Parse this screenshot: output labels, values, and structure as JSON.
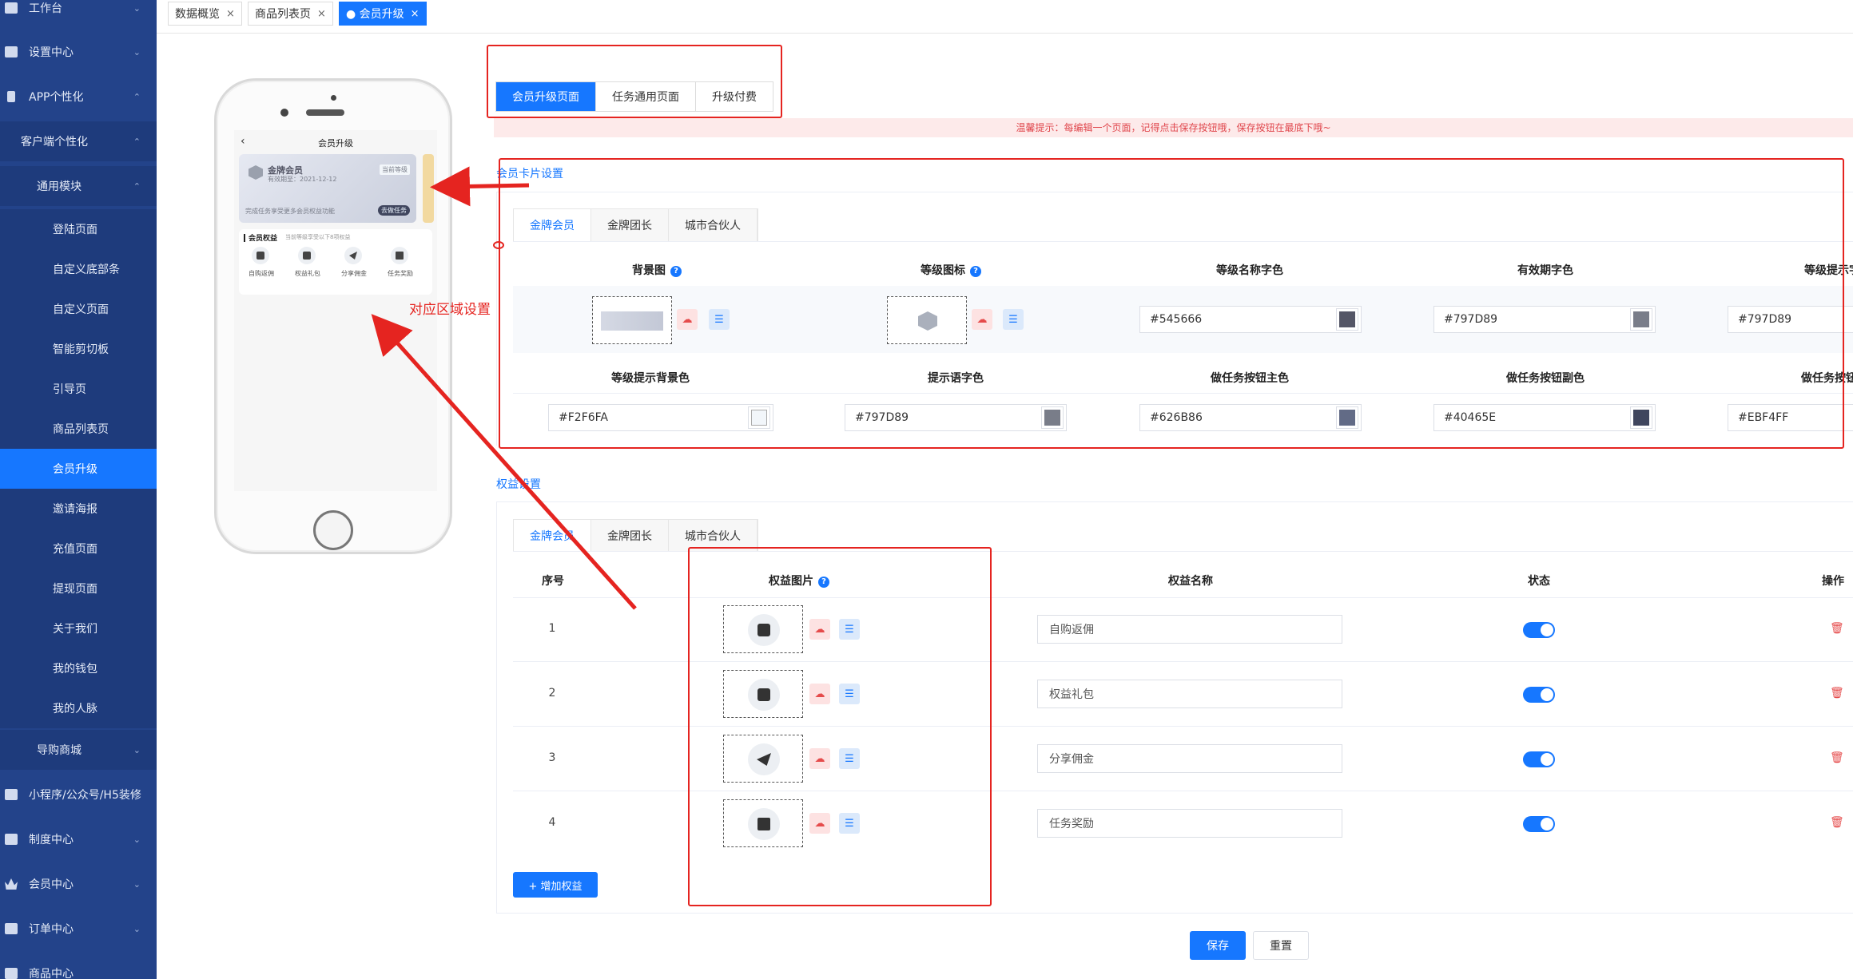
{
  "sidebar": {
    "items": [
      {
        "label": "工作台",
        "chevron": "⌄"
      },
      {
        "label": "设置中心",
        "chevron": "⌄"
      },
      {
        "label": "APP个性化",
        "chevron": "⌃"
      },
      {
        "label": "客户端个性化",
        "chevron": "⌃"
      },
      {
        "label": "通用模块",
        "chevron": "⌃"
      },
      {
        "label": "登陆页面"
      },
      {
        "label": "自定义底部条"
      },
      {
        "label": "自定义页面"
      },
      {
        "label": "智能剪切板"
      },
      {
        "label": "引导页"
      },
      {
        "label": "商品列表页"
      },
      {
        "label": "会员升级"
      },
      {
        "label": "邀请海报"
      },
      {
        "label": "充值页面"
      },
      {
        "label": "提现页面"
      },
      {
        "label": "关于我们"
      },
      {
        "label": "我的钱包"
      },
      {
        "label": "我的人脉"
      },
      {
        "label": "导购商城",
        "chevron": "⌄"
      },
      {
        "label": "小程序/公众号/H5装修"
      },
      {
        "label": "制度中心",
        "chevron": "⌄"
      },
      {
        "label": "会员中心",
        "chevron": "⌄"
      },
      {
        "label": "订单中心",
        "chevron": "⌄"
      },
      {
        "label": "商品中心"
      }
    ]
  },
  "page_tabs": [
    {
      "label": "数据概览",
      "close": "×"
    },
    {
      "label": "商品列表页",
      "close": "×"
    },
    {
      "label": "● 会员升级",
      "close": "×"
    }
  ],
  "phone": {
    "title": "会员升级",
    "back": "‹",
    "card_name": "金牌会员",
    "card_expiry": "有效期至：2021-12-12",
    "card_badge": "当前等级",
    "card_tip": "完成任务享受更多会员权益功能",
    "card_btn": "去做任务",
    "rights_title": "会员权益",
    "rights_sub": "当前等级享受以下8项权益",
    "rights": [
      "自购返佣",
      "权益礼包",
      "分享佣金",
      "任务奖励"
    ]
  },
  "annotation_label": "对应区域设置",
  "top_tabs": [
    "会员升级页面",
    "任务通用页面",
    "升级付费"
  ],
  "notice": "温馨提示：每编辑一个页面，记得点击保存按钮哦，保存按钮在最底下哦~",
  "card_section": {
    "title": "会员卡片设置",
    "tabs": [
      "金牌会员",
      "金牌团长",
      "城市合伙人"
    ],
    "row1_headers": [
      "背景图",
      "等级图标",
      "等级名称字色",
      "有效期字色",
      "等级提示字色"
    ],
    "row2_headers": [
      "等级提示背景色",
      "提示语字色",
      "做任务按钮主色",
      "做任务按钮副色",
      "做任务按钮字色"
    ],
    "row1_values": [
      "#545666",
      "#797D89",
      "#797D89"
    ],
    "row2_values": [
      "#F2F6FA",
      "#797D89",
      "#626B86",
      "#40465E",
      "#EBF4FF"
    ],
    "swatches_row1": [
      "#545666",
      "#797D89",
      "#797D89"
    ],
    "swatches_row2": [
      "#F2F6FA",
      "#797D89",
      "#626B86",
      "#40465E",
      "#EBF4FF"
    ]
  },
  "rights_section": {
    "title": "权益设置",
    "tabs": [
      "金牌会员",
      "金牌团长",
      "城市合伙人"
    ],
    "headers": [
      "序号",
      "权益图片",
      "权益名称",
      "状态",
      "操作"
    ],
    "rows": [
      {
        "seq": "1",
        "name": "自购返佣"
      },
      {
        "seq": "2",
        "name": "权益礼包"
      },
      {
        "seq": "3",
        "name": "分享佣金"
      },
      {
        "seq": "4",
        "name": "任务奖励"
      }
    ],
    "add_button": "+ 增加权益"
  },
  "footer": {
    "save": "保存",
    "reset": "重置"
  },
  "colors": {
    "accent": "#1677ff",
    "sidebar": "#23438a",
    "annotation": "#e52420"
  }
}
